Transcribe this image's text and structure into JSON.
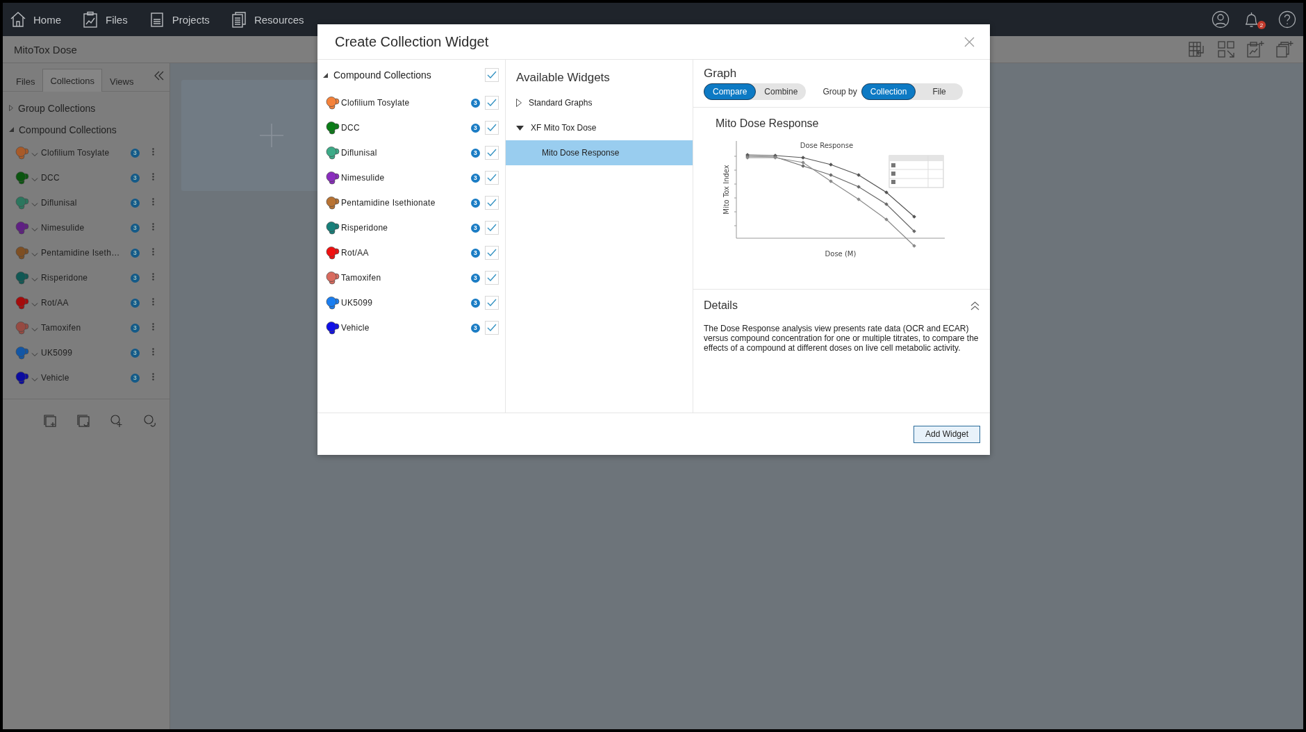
{
  "nav": [
    {
      "label": "Home"
    },
    {
      "label": "Files"
    },
    {
      "label": "Projects"
    },
    {
      "label": "Resources"
    }
  ],
  "notification_count": "2",
  "page_title": "MitoTox Dose",
  "sidebar": {
    "tabs": [
      {
        "label": "Files",
        "selected": false
      },
      {
        "label": "Collections",
        "selected": true
      },
      {
        "label": "Views",
        "selected": false
      }
    ],
    "groups": [
      {
        "label": "Group Collections",
        "expanded": false
      },
      {
        "label": "Compound Collections",
        "expanded": true,
        "items": [
          {
            "name": "Clofilium Tosylate",
            "color": "#a85a28",
            "count": "3"
          },
          {
            "name": "DCC",
            "color": "#0a550f",
            "count": "3"
          },
          {
            "name": "Diflunisal",
            "color": "#2b765e",
            "count": "3"
          },
          {
            "name": "Nimesulide",
            "color": "#5f1f83",
            "count": "3"
          },
          {
            "name": "Pentamidine Iseth…",
            "color": "#7e4f23",
            "count": "3"
          },
          {
            "name": "Risperidone",
            "color": "#105854",
            "count": "3"
          },
          {
            "name": "Rot/AA",
            "color": "#a50b0b",
            "count": "3"
          },
          {
            "name": "Tamoxifen",
            "color": "#964a42",
            "count": "3"
          },
          {
            "name": "UK5099",
            "color": "#1256a5",
            "count": "3"
          },
          {
            "name": "Vehicle",
            "color": "#0b0ba0",
            "count": "3"
          }
        ]
      }
    ]
  },
  "dialog": {
    "title": "Create Collection Widget",
    "collections": {
      "label": "Compound Collections",
      "expanded": true,
      "checked": true,
      "items": [
        {
          "name": "Clofilium Tosylate",
          "color": "#f5823a",
          "count": "3",
          "checked": true
        },
        {
          "name": "DCC",
          "color": "#0a7d17",
          "count": "3",
          "checked": true
        },
        {
          "name": "Diflunisal",
          "color": "#3dab88",
          "count": "3",
          "checked": true
        },
        {
          "name": "Nimesulide",
          "color": "#8a2dbe",
          "count": "3",
          "checked": true
        },
        {
          "name": "Pentamidine Isethionate",
          "color": "#b87333",
          "count": "3",
          "checked": true
        },
        {
          "name": "Risperidone",
          "color": "#17807a",
          "count": "3",
          "checked": true
        },
        {
          "name": "Rot/AA",
          "color": "#f01010",
          "count": "3",
          "checked": true
        },
        {
          "name": "Tamoxifen",
          "color": "#d96b5f",
          "count": "3",
          "checked": true
        },
        {
          "name": "UK5099",
          "color": "#1a7ef0",
          "count": "3",
          "checked": true
        },
        {
          "name": "Vehicle",
          "color": "#1010e8",
          "count": "3",
          "checked": true
        }
      ]
    },
    "widgets_title": "Available Widgets",
    "widgets": [
      {
        "label": "Standard Graphs",
        "expanded": false
      },
      {
        "label": "XF Mito Tox Dose",
        "expanded": true,
        "children": [
          {
            "label": "Mito Dose Response",
            "selected": true
          }
        ]
      }
    ],
    "graph": {
      "title": "Graph",
      "modes": [
        {
          "label": "Compare",
          "selected": true
        },
        {
          "label": "Combine",
          "selected": false
        }
      ],
      "group_by_label": "Group by",
      "group_by": [
        {
          "label": "Collection",
          "selected": true
        },
        {
          "label": "File",
          "selected": false
        }
      ]
    },
    "preview": {
      "title": "Mito Dose Response",
      "chart_title": "Dose Response",
      "xlabel": "Dose (M)",
      "ylabel": "Mito Tox Index"
    },
    "details": {
      "title": "Details",
      "expanded": true,
      "text": "The Dose Response analysis view presents rate data (OCR and ECAR) versus compound concentration for one or multiple titrates, to compare the effects of a compound at different doses on live cell metabolic activity."
    },
    "add_button": "Add Widget"
  }
}
